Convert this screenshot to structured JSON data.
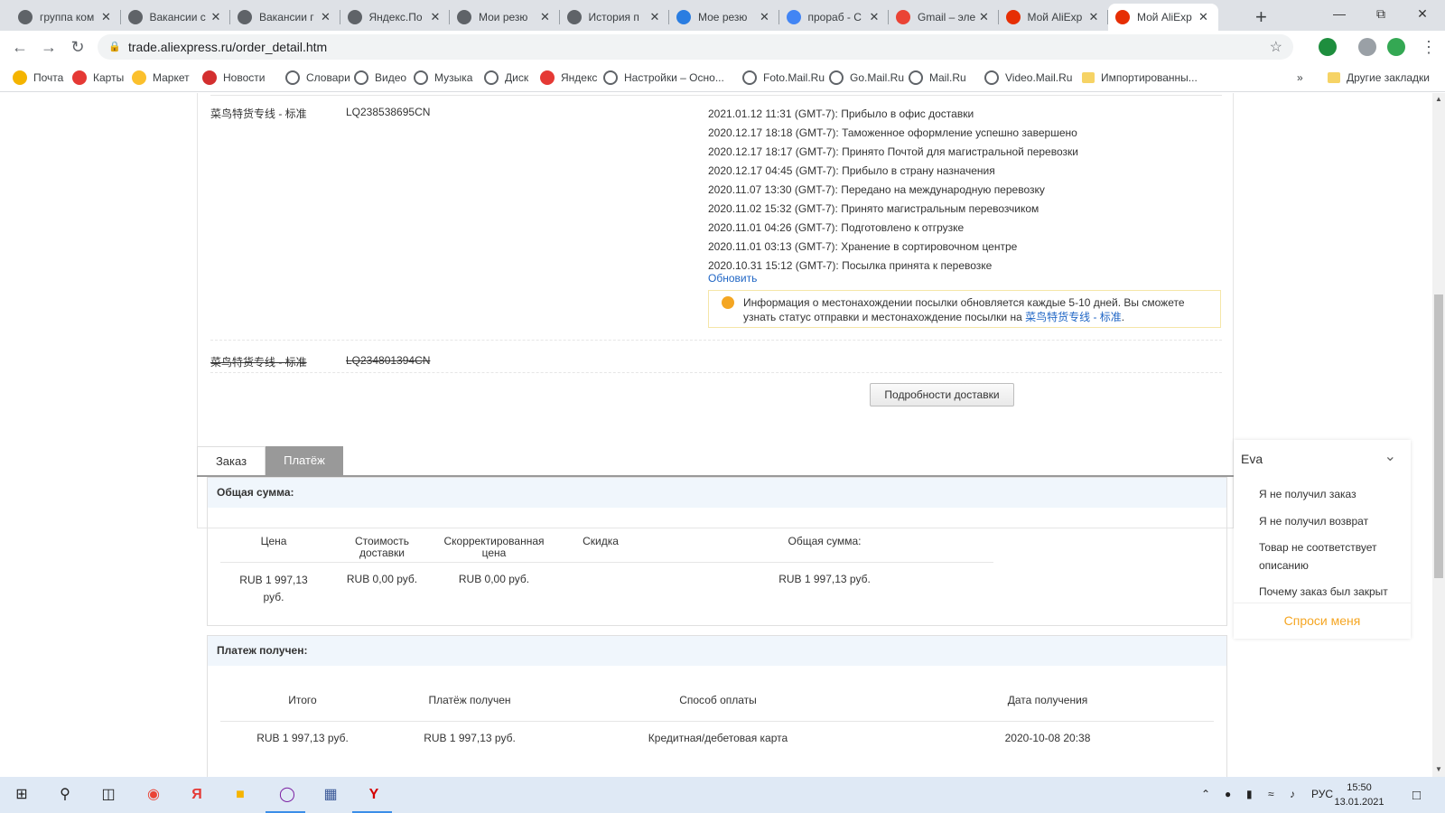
{
  "browser": {
    "tabs": [
      {
        "title": "группа ком",
        "icon": "globe-icon",
        "color": "#5f6368"
      },
      {
        "title": "Вакансии с",
        "icon": "globe-icon",
        "color": "#5f6368"
      },
      {
        "title": "Вакансии г",
        "icon": "globe-icon",
        "color": "#5f6368"
      },
      {
        "title": "Яндекс.По",
        "icon": "globe-icon",
        "color": "#5f6368"
      },
      {
        "title": "Мои резю",
        "icon": "globe-icon",
        "color": "#5f6368"
      },
      {
        "title": "История п",
        "icon": "globe-icon",
        "color": "#5f6368"
      },
      {
        "title": "Мое резю",
        "icon": "snowflake-icon",
        "color": "#2a7de1"
      },
      {
        "title": "прораб - С",
        "icon": "google-icon",
        "color": "#4285f4"
      },
      {
        "title": "Gmail – эле",
        "icon": "gmail-icon",
        "color": "#ea4335"
      },
      {
        "title": "Мой AliExp",
        "icon": "aliexpress-icon",
        "color": "#e62e04"
      },
      {
        "title": "Мой AliExp",
        "icon": "aliexpress-icon",
        "color": "#e62e04",
        "active": true
      }
    ],
    "url": "trade.aliexpress.ru/order_detail.htm",
    "bookmarks": [
      {
        "label": "Почта",
        "icon": "mail-icon",
        "color": "#f4b400"
      },
      {
        "label": "Карты",
        "icon": "map-pin-icon",
        "color": "#e53935"
      },
      {
        "label": "Маркет",
        "icon": "market-icon",
        "color": "#fbc02d"
      },
      {
        "label": "Новости",
        "icon": "news-icon",
        "color": "#d32f2f"
      },
      {
        "label": "Словари",
        "icon": "globe-icon",
        "color": "#5f6368"
      },
      {
        "label": "Видео",
        "icon": "globe-icon",
        "color": "#5f6368"
      },
      {
        "label": "Музыка",
        "icon": "globe-icon",
        "color": "#5f6368"
      },
      {
        "label": "Диск",
        "icon": "globe-icon",
        "color": "#5f6368"
      },
      {
        "label": "Яндекс",
        "icon": "yandex-icon",
        "color": "#e53935"
      },
      {
        "label": "Настройки – Осно...",
        "icon": "globe-icon",
        "color": "#5f6368"
      },
      {
        "label": "Foto.Mail.Ru",
        "icon": "globe-icon",
        "color": "#5f6368"
      },
      {
        "label": "Go.Mail.Ru",
        "icon": "globe-icon",
        "color": "#5f6368"
      },
      {
        "label": "Mail.Ru",
        "icon": "globe-icon",
        "color": "#5f6368"
      },
      {
        "label": "Video.Mail.Ru",
        "icon": "globe-icon",
        "color": "#5f6368"
      },
      {
        "label": "Импортированны...",
        "icon": "folder-icon",
        "color": "#f6d365"
      }
    ],
    "other_bookmarks": "Другие закладки"
  },
  "shipping": {
    "carrier": "菜鸟特货专线 - 标准",
    "tracking_number": "LQ238538695CN",
    "events": [
      "2021.01.12 11:31 (GMT-7): Прибыло в офис доставки",
      "2020.12.17 18:18 (GMT-7): Таможенное оформление успешно завершено",
      "2020.12.17 18:17 (GMT-7): Принято Почтой для магистральной перевозки",
      "2020.12.17 04:45 (GMT-7): Прибыло в страну назначения",
      "2020.11.07 13:30 (GMT-7): Передано на международную перевозку",
      "2020.11.02 15:32 (GMT-7): Принято магистральным перевозчиком",
      "2020.11.01 04:26 (GMT-7): Подготовлено к отгрузке",
      "2020.11.01 03:13 (GMT-7): Хранение в сортировочном центре",
      "2020.10.31 15:12 (GMT-7): Посылка принята к перевозке"
    ],
    "refresh_label": "Обновить",
    "info_text": "Информация о местонахождении посылки обновляется каждые 5-10 дней. Вы сможете узнать статус отправки и местонахождение посылки на ",
    "info_link": "菜鸟特货专线 - 标准",
    "info_end": ".",
    "old_carrier": "菜鸟特货专线 - 标准",
    "old_tracking_number": "LQ234801394CN",
    "details_button": "Подробности доставки"
  },
  "order_tabs": {
    "order": "Заказ",
    "payment": "Платёж"
  },
  "total_section": {
    "title": "Общая сумма:",
    "headers": {
      "price": "Цена",
      "shipping": "Стоимость доставки",
      "adjusted": "Скорректированная цена",
      "discount": "Скидка",
      "total": "Общая сумма:"
    },
    "values": {
      "price": "RUB 1 997,13 руб.",
      "shipping": "RUB 0,00 руб.",
      "adjusted": "RUB 0,00 руб.",
      "discount": "",
      "total": "RUB 1 997,13 руб."
    }
  },
  "payment_section": {
    "title": "Платеж получен:",
    "headers": {
      "total": "Итого",
      "received": "Платёж получен",
      "method": "Способ оплаты",
      "date": "Дата получения"
    },
    "values": {
      "total": "RUB 1 997,13 руб.",
      "received": "RUB 1 997,13 руб.",
      "method": "Кредитная/дебетовая карта",
      "date": "2020-10-08 20:38"
    }
  },
  "chat": {
    "name": "Eva",
    "questions": [
      "Я не получил заказ",
      "Я не получил возврат",
      "Товар не соответствует описанию",
      "Почему заказ был закрыт"
    ],
    "ask_label": "Спроси меня"
  },
  "taskbar": {
    "lang": "РУС",
    "time": "15:50",
    "date": "13.01.2021"
  }
}
